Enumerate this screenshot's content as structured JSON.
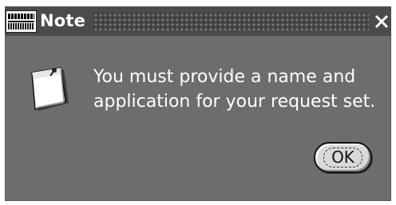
{
  "dialog": {
    "title": "Note",
    "app_logo_icon": "oracle-applications-logo",
    "close_icon": "close-icon",
    "note_icon": "note-paper-icon",
    "message_line1": "You must provide a name and",
    "message_line2": "application for your request set.",
    "ok_label": "OK"
  },
  "colors": {
    "background": "#6d6d6d",
    "titlebar": "#4b4b4b",
    "text": "#ffffff",
    "button_face": "#d9d9d9"
  }
}
